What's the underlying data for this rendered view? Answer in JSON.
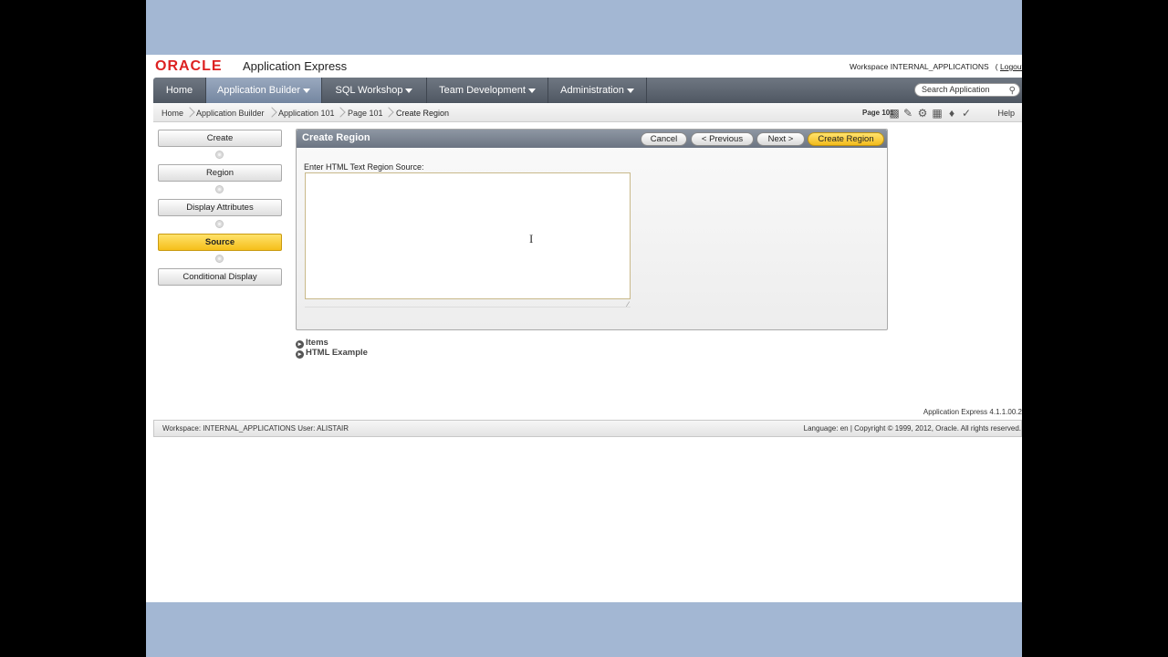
{
  "header": {
    "logo": "ORACLE",
    "product": "Application Express",
    "workspace_text": "Workspace INTERNAL_APPLICATIONS",
    "logout_label": "Logout"
  },
  "tabs": [
    {
      "label": "Home"
    },
    {
      "label": "Application Builder"
    },
    {
      "label": "SQL Workshop"
    },
    {
      "label": "Team Development"
    },
    {
      "label": "Administration"
    }
  ],
  "search": {
    "placeholder": "Search Application"
  },
  "breadcrumb": [
    "Home",
    "Application Builder",
    "Application 101",
    "Page 101",
    "Create Region"
  ],
  "toolbar": {
    "page_label": "Page 101",
    "help_label": "Help"
  },
  "wizard_steps": [
    {
      "label": "Create"
    },
    {
      "label": "Region"
    },
    {
      "label": "Display Attributes"
    },
    {
      "label": "Source"
    },
    {
      "label": "Conditional Display"
    }
  ],
  "region": {
    "title": "Create Region",
    "buttons": {
      "cancel": "Cancel",
      "previous": "< Previous",
      "next": "Next >",
      "create": "Create Region"
    },
    "source_label": "Enter HTML Text Region Source:",
    "source_value": ""
  },
  "links": {
    "items": "Items",
    "html_example": "HTML Example"
  },
  "footer": {
    "version": "Application Express 4.1.1.00.2",
    "left": "Workspace: INTERNAL_APPLICATIONS User: ALISTAIR",
    "right": "Language: en | Copyright © 1999, 2012, Oracle. All rights reserved."
  },
  "colors": {
    "accent": "#f5bf1a",
    "tabbar": "#5a626d",
    "brand": "#dd2222",
    "frame": "#a3b7d3"
  }
}
